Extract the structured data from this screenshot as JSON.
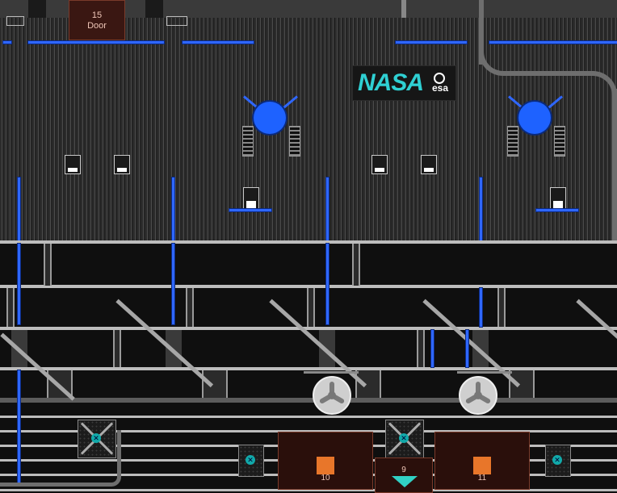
{
  "logo": {
    "primary": "NASA",
    "secondary": "esa"
  },
  "door": {
    "number": "15",
    "label": "Door"
  },
  "modules": [
    {
      "number": "10"
    },
    {
      "number": "9"
    },
    {
      "number": "11"
    }
  ],
  "colors": {
    "conduit": "#2f67ff",
    "module_fill": "#2a0f0b",
    "module_square": "#e8762a",
    "indicator": "#31d1c5",
    "logo_text": "#2fd0d3"
  },
  "icons": [
    "docking-port-icon",
    "fan-icon",
    "generator-icon",
    "sensor-icon",
    "down-arrow-icon"
  ]
}
